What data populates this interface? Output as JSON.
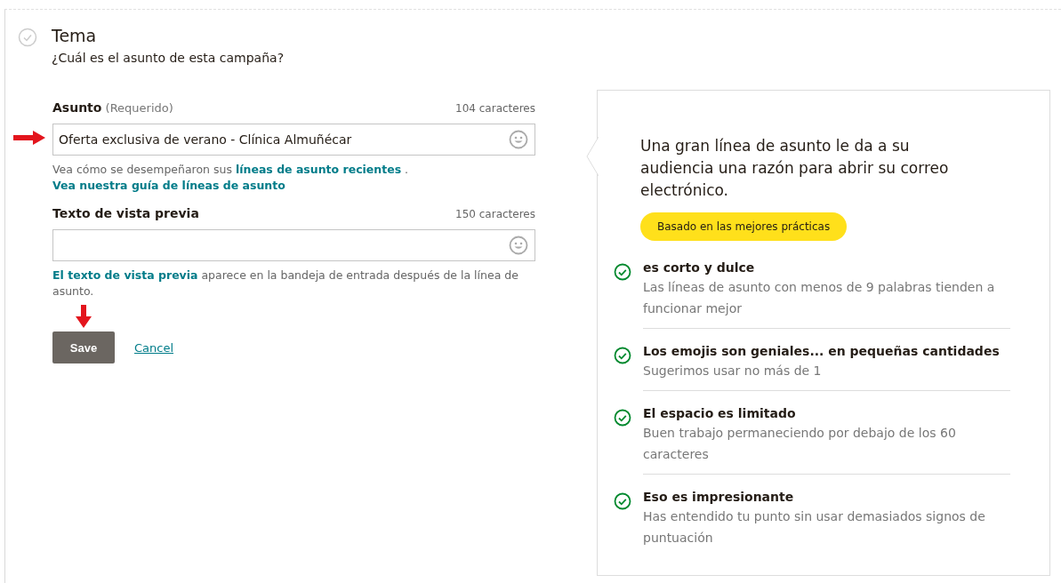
{
  "section": {
    "title": "Tema",
    "subtitle": "¿Cuál es el asunto de esta campaña?",
    "done": false
  },
  "fields": [
    {
      "label": "Asunto",
      "qualifier": "(Requerido)",
      "counter": "104 caracteres",
      "value": "Oferta exclusiva de verano - Clínica Almuñécar",
      "hint": [
        {
          "kind": "text",
          "text": "Vea cómo se desempeñaron sus "
        },
        {
          "kind": "link",
          "text": "líneas de asunto recientes"
        },
        {
          "kind": "text",
          "text": " . "
        },
        {
          "kind": "link",
          "text": "Vea nuestra guía de líneas de asunto"
        }
      ]
    },
    {
      "label": "Texto de vista previa",
      "counter": "150 caracteres",
      "hint": [
        {
          "kind": "link",
          "text": "El texto de vista previa"
        },
        {
          "kind": "text",
          "text": " aparece en la bandeja de entrada después de la línea de asunto."
        }
      ]
    }
  ],
  "buttons": {
    "save": "Save",
    "cancel": "Cancel"
  },
  "tips": {
    "heading": "Una gran línea de asunto le da a su audiencia una razón para abrir su correo electrónico.",
    "badge": "Basado en las mejores prácticas",
    "items": [
      {
        "title": "es corto y dulce",
        "text": "Las líneas de asunto con menos de 9 palabras tienden a funcionar mejor",
        "passed": true
      },
      {
        "title": "Los emojis son geniales... en pequeñas cantidades",
        "text": "Sugerimos usar no más de 1",
        "passed": true
      },
      {
        "title": "El espacio es limitado",
        "text": "Buen trabajo permaneciendo por debajo de los 60 caracteres",
        "passed": true
      },
      {
        "title": "Eso es impresionante",
        "text": "Has entendido tu punto sin usar demasiados signos de puntuación",
        "passed": true
      }
    ]
  }
}
